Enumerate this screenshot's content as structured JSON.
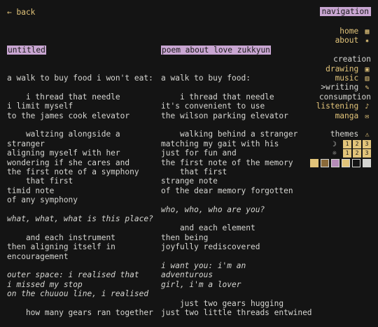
{
  "header": {
    "back": "← back",
    "navigation": "navigation"
  },
  "left_poem": {
    "title": "untitled",
    "lines": [
      {
        "t": "a walk to buy food i won't eat:"
      },
      {
        "t": ""
      },
      {
        "t": "    i thread that needle"
      },
      {
        "t": "i limit myself"
      },
      {
        "t": "to the james cook elevator"
      },
      {
        "t": ""
      },
      {
        "t": "    waltzing alongside a"
      },
      {
        "t": "stranger"
      },
      {
        "t": "aligning myself with her"
      },
      {
        "t": "wondering if she cares and"
      },
      {
        "t": "the first note of a symphony"
      },
      {
        "t": "    that first"
      },
      {
        "t": "timid note"
      },
      {
        "t": "of any symphony"
      },
      {
        "t": ""
      },
      {
        "t": "what, what, what is this place?",
        "i": true
      },
      {
        "t": ""
      },
      {
        "t": "    and each instrument"
      },
      {
        "t": "then aligning itself in"
      },
      {
        "t": "encouragement"
      },
      {
        "t": ""
      },
      {
        "t": "outer space: i realised that",
        "i": true
      },
      {
        "t": "i missed my stop",
        "i": true
      },
      {
        "t": "on the chuuou line, i realised",
        "i": true
      },
      {
        "t": ""
      },
      {
        "t": "    how many gears ran together"
      }
    ]
  },
  "right_poem": {
    "title": "poem about love zukkyun",
    "lines": [
      {
        "t": "a walk to buy food:"
      },
      {
        "t": ""
      },
      {
        "t": "    i thread that needle"
      },
      {
        "t": "it's convenient to use"
      },
      {
        "t": "the wilson parking elevator"
      },
      {
        "t": ""
      },
      {
        "t": "    walking behind a stranger"
      },
      {
        "t": "matching my gait with his"
      },
      {
        "t": "just for fun and"
      },
      {
        "t": "the first note of the memory"
      },
      {
        "t": "    that first"
      },
      {
        "t": "strange note"
      },
      {
        "t": "of the dear memory forgotten"
      },
      {
        "t": ""
      },
      {
        "t": "who, who, who are you?",
        "i": true
      },
      {
        "t": ""
      },
      {
        "t": "    and each element"
      },
      {
        "t": "then being"
      },
      {
        "t": "joyfully rediscovered"
      },
      {
        "t": ""
      },
      {
        "t": "i want you: i'm an",
        "i": true
      },
      {
        "t": "adventurous",
        "i": true
      },
      {
        "t": "girl, i'm a lover",
        "i": true
      },
      {
        "t": ""
      },
      {
        "t": "    just two gears hugging"
      },
      {
        "t": "just two little threads entwined"
      }
    ]
  },
  "sidebar": {
    "home": "home",
    "home_icon": "▦",
    "about": "about",
    "about_icon": "✷",
    "creation": "creation",
    "drawing": "drawing",
    "drawing_icon": "▣",
    "music": "music",
    "music_icon": "▥",
    "writing": ">writing",
    "writing_icon": "✎",
    "consumption": "consumption",
    "listening": "listening",
    "listening_icon": "♪",
    "manga": "manga",
    "manga_icon": "✉",
    "themes": "themes",
    "themes_icon": "⚠",
    "moon_icon": "☽",
    "sun_icon": "☼",
    "theme_numbers": [
      "1",
      "2",
      "3",
      "1",
      "2",
      "3"
    ]
  },
  "colors": {
    "accent": "#e2c47a",
    "highlight": "#c9a6d2",
    "bg": "#141414",
    "text": "#d6d6d2"
  }
}
